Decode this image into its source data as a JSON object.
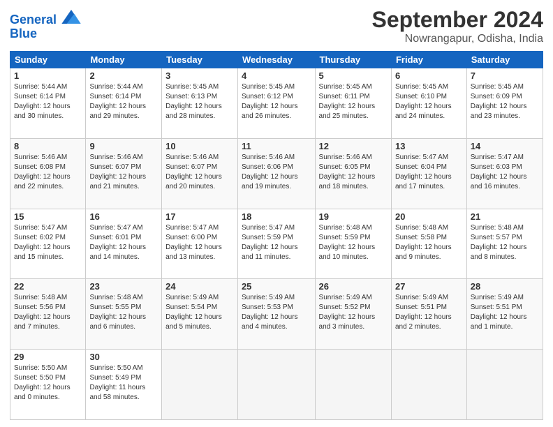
{
  "header": {
    "logo_line1": "General",
    "logo_line2": "Blue",
    "month": "September 2024",
    "location": "Nowrangapur, Odisha, India"
  },
  "weekdays": [
    "Sunday",
    "Monday",
    "Tuesday",
    "Wednesday",
    "Thursday",
    "Friday",
    "Saturday"
  ],
  "weeks": [
    [
      {
        "day": "1",
        "info": "Sunrise: 5:44 AM\nSunset: 6:14 PM\nDaylight: 12 hours\nand 30 minutes."
      },
      {
        "day": "2",
        "info": "Sunrise: 5:44 AM\nSunset: 6:14 PM\nDaylight: 12 hours\nand 29 minutes."
      },
      {
        "day": "3",
        "info": "Sunrise: 5:45 AM\nSunset: 6:13 PM\nDaylight: 12 hours\nand 28 minutes."
      },
      {
        "day": "4",
        "info": "Sunrise: 5:45 AM\nSunset: 6:12 PM\nDaylight: 12 hours\nand 26 minutes."
      },
      {
        "day": "5",
        "info": "Sunrise: 5:45 AM\nSunset: 6:11 PM\nDaylight: 12 hours\nand 25 minutes."
      },
      {
        "day": "6",
        "info": "Sunrise: 5:45 AM\nSunset: 6:10 PM\nDaylight: 12 hours\nand 24 minutes."
      },
      {
        "day": "7",
        "info": "Sunrise: 5:45 AM\nSunset: 6:09 PM\nDaylight: 12 hours\nand 23 minutes."
      }
    ],
    [
      {
        "day": "8",
        "info": "Sunrise: 5:46 AM\nSunset: 6:08 PM\nDaylight: 12 hours\nand 22 minutes."
      },
      {
        "day": "9",
        "info": "Sunrise: 5:46 AM\nSunset: 6:07 PM\nDaylight: 12 hours\nand 21 minutes."
      },
      {
        "day": "10",
        "info": "Sunrise: 5:46 AM\nSunset: 6:07 PM\nDaylight: 12 hours\nand 20 minutes."
      },
      {
        "day": "11",
        "info": "Sunrise: 5:46 AM\nSunset: 6:06 PM\nDaylight: 12 hours\nand 19 minutes."
      },
      {
        "day": "12",
        "info": "Sunrise: 5:46 AM\nSunset: 6:05 PM\nDaylight: 12 hours\nand 18 minutes."
      },
      {
        "day": "13",
        "info": "Sunrise: 5:47 AM\nSunset: 6:04 PM\nDaylight: 12 hours\nand 17 minutes."
      },
      {
        "day": "14",
        "info": "Sunrise: 5:47 AM\nSunset: 6:03 PM\nDaylight: 12 hours\nand 16 minutes."
      }
    ],
    [
      {
        "day": "15",
        "info": "Sunrise: 5:47 AM\nSunset: 6:02 PM\nDaylight: 12 hours\nand 15 minutes."
      },
      {
        "day": "16",
        "info": "Sunrise: 5:47 AM\nSunset: 6:01 PM\nDaylight: 12 hours\nand 14 minutes."
      },
      {
        "day": "17",
        "info": "Sunrise: 5:47 AM\nSunset: 6:00 PM\nDaylight: 12 hours\nand 13 minutes."
      },
      {
        "day": "18",
        "info": "Sunrise: 5:47 AM\nSunset: 5:59 PM\nDaylight: 12 hours\nand 11 minutes."
      },
      {
        "day": "19",
        "info": "Sunrise: 5:48 AM\nSunset: 5:59 PM\nDaylight: 12 hours\nand 10 minutes."
      },
      {
        "day": "20",
        "info": "Sunrise: 5:48 AM\nSunset: 5:58 PM\nDaylight: 12 hours\nand 9 minutes."
      },
      {
        "day": "21",
        "info": "Sunrise: 5:48 AM\nSunset: 5:57 PM\nDaylight: 12 hours\nand 8 minutes."
      }
    ],
    [
      {
        "day": "22",
        "info": "Sunrise: 5:48 AM\nSunset: 5:56 PM\nDaylight: 12 hours\nand 7 minutes."
      },
      {
        "day": "23",
        "info": "Sunrise: 5:48 AM\nSunset: 5:55 PM\nDaylight: 12 hours\nand 6 minutes."
      },
      {
        "day": "24",
        "info": "Sunrise: 5:49 AM\nSunset: 5:54 PM\nDaylight: 12 hours\nand 5 minutes."
      },
      {
        "day": "25",
        "info": "Sunrise: 5:49 AM\nSunset: 5:53 PM\nDaylight: 12 hours\nand 4 minutes."
      },
      {
        "day": "26",
        "info": "Sunrise: 5:49 AM\nSunset: 5:52 PM\nDaylight: 12 hours\nand 3 minutes."
      },
      {
        "day": "27",
        "info": "Sunrise: 5:49 AM\nSunset: 5:51 PM\nDaylight: 12 hours\nand 2 minutes."
      },
      {
        "day": "28",
        "info": "Sunrise: 5:49 AM\nSunset: 5:51 PM\nDaylight: 12 hours\nand 1 minute."
      }
    ],
    [
      {
        "day": "29",
        "info": "Sunrise: 5:50 AM\nSunset: 5:50 PM\nDaylight: 12 hours\nand 0 minutes."
      },
      {
        "day": "30",
        "info": "Sunrise: 5:50 AM\nSunset: 5:49 PM\nDaylight: 11 hours\nand 58 minutes."
      },
      {
        "day": "",
        "info": ""
      },
      {
        "day": "",
        "info": ""
      },
      {
        "day": "",
        "info": ""
      },
      {
        "day": "",
        "info": ""
      },
      {
        "day": "",
        "info": ""
      }
    ]
  ],
  "colors": {
    "header_bg": "#1565c0",
    "logo_blue": "#1565c0"
  }
}
